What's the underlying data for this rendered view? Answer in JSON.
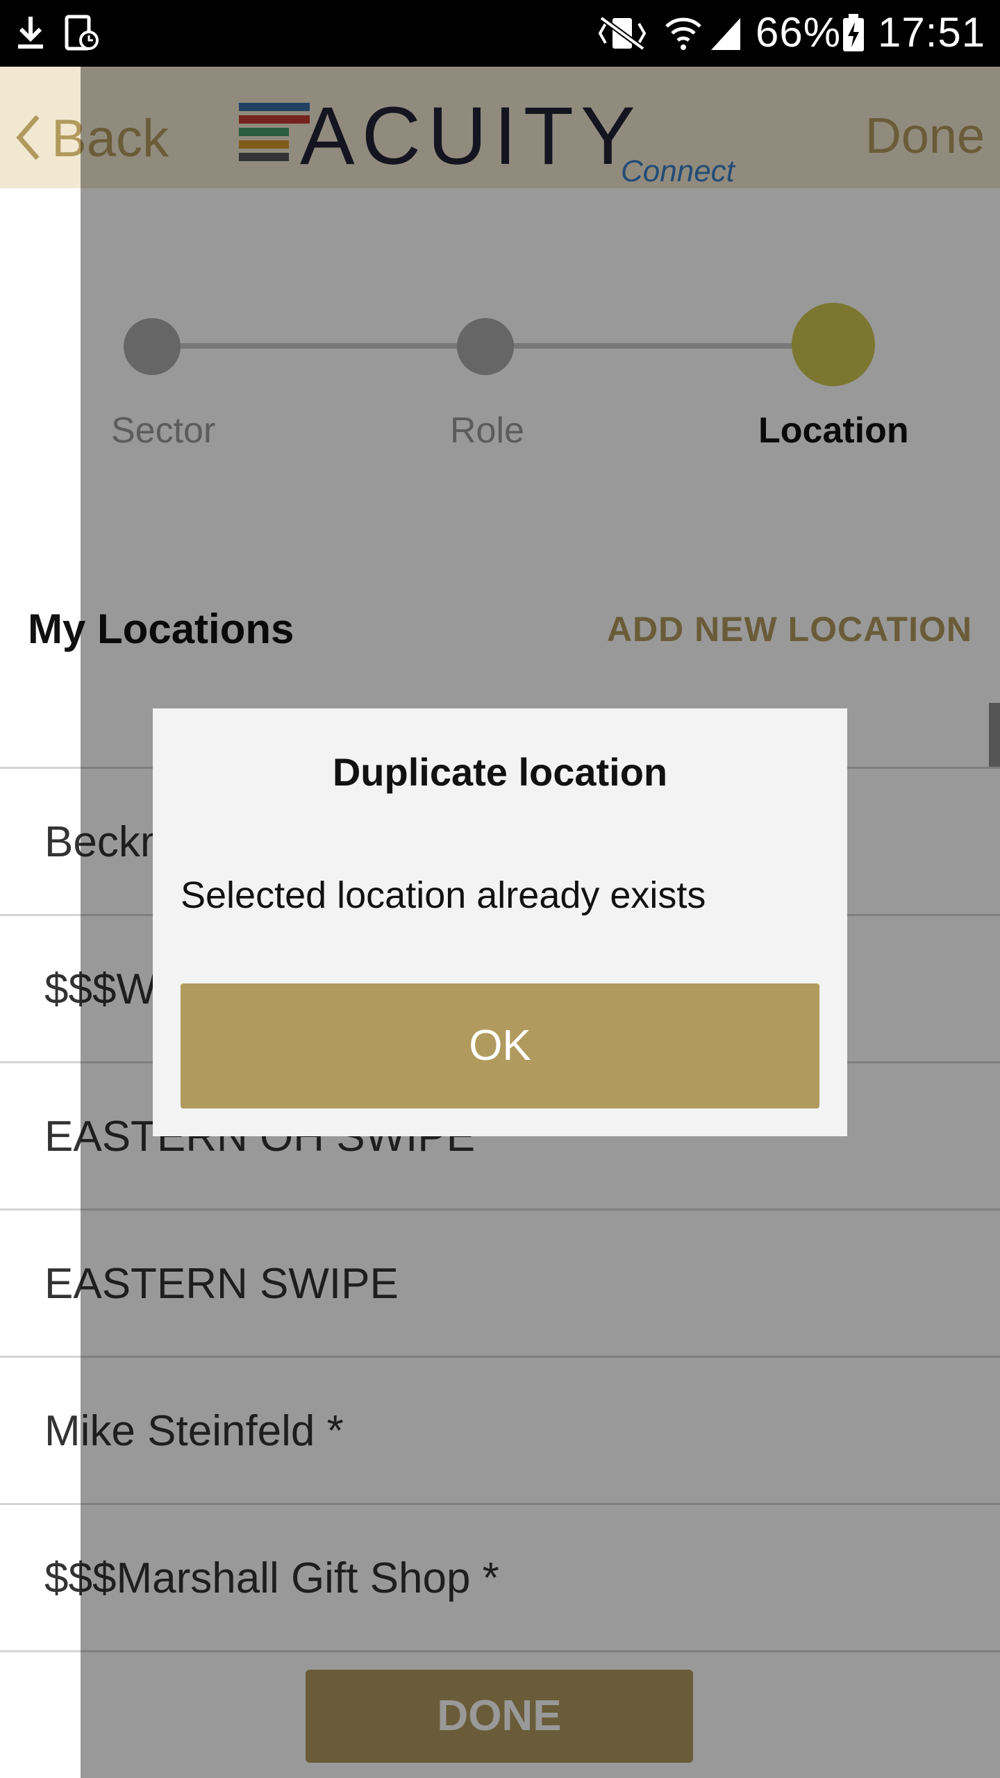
{
  "status_bar": {
    "battery": "66%",
    "time": "17:51"
  },
  "header": {
    "back_label": "Back",
    "logo_text": "ACUITY",
    "logo_sub": "Connect",
    "done_label": "Done"
  },
  "stepper": {
    "steps": [
      {
        "label": "Sector"
      },
      {
        "label": "Role"
      },
      {
        "label": "Location"
      }
    ]
  },
  "section": {
    "title": "My Locations",
    "add_label": "ADD NEW LOCATION"
  },
  "locations": [
    "Beckman The Buzz",
    "$$$Washington Group I",
    "EASTERN OH SWIPE",
    "EASTERN SWIPE",
    "Mike Steinfeld *",
    "$$$Marshall Gift Shop *"
  ],
  "done_button": "DONE",
  "dialog": {
    "title": "Duplicate location",
    "message": "Selected location already exists",
    "ok_label": "OK"
  },
  "colors": {
    "accent": "#b19a5e",
    "header_bg": "#f2e8d2",
    "active_step": "#cdc650",
    "inactive_step": "#aaaaaa"
  }
}
